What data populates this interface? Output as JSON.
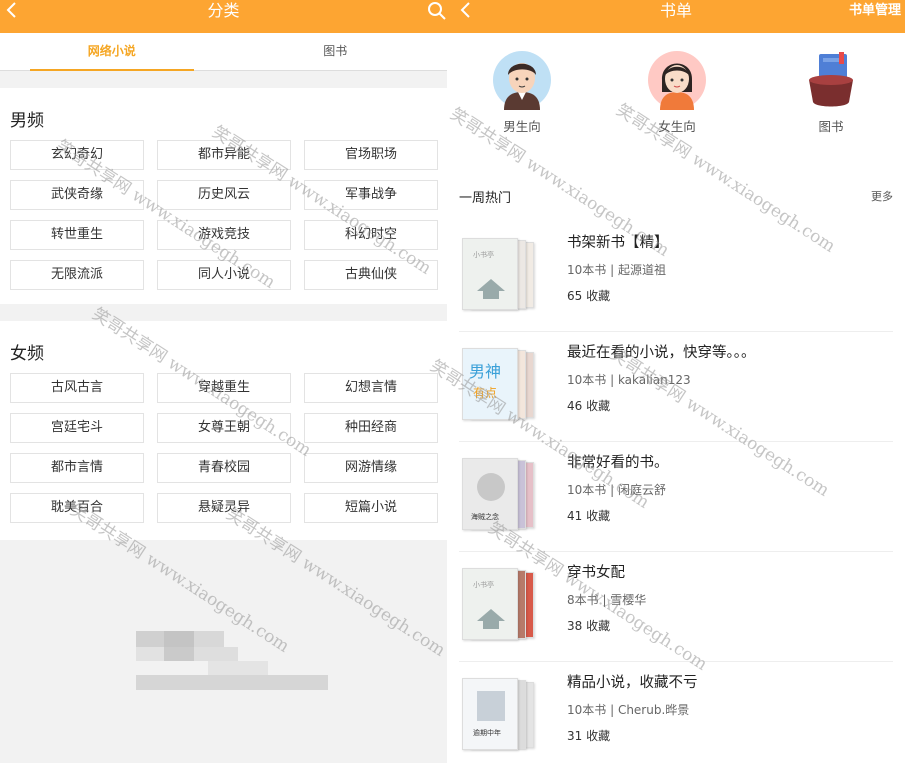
{
  "left": {
    "title": "分类",
    "tabs": [
      {
        "label": "网络小说",
        "active": true
      },
      {
        "label": "图书",
        "active": false
      }
    ],
    "sections": [
      {
        "title": "男频",
        "chips": [
          "玄幻奇幻",
          "都市异能",
          "官场职场",
          "武侠奇缘",
          "历史风云",
          "军事战争",
          "转世重生",
          "游戏竞技",
          "科幻时空",
          "无限流派",
          "同人小说",
          "古典仙侠"
        ]
      },
      {
        "title": "女频",
        "chips": [
          "古风古言",
          "穿越重生",
          "幻想言情",
          "宫廷宅斗",
          "女尊王朝",
          "种田经商",
          "都市言情",
          "青春校园",
          "网游情缘",
          "耽美百合",
          "悬疑灵异",
          "短篇小说"
        ]
      }
    ]
  },
  "right": {
    "title": "书单",
    "manage_label": "书单管理",
    "categories": [
      {
        "label": "男生向",
        "icon": "male-avatar-icon"
      },
      {
        "label": "女生向",
        "icon": "female-avatar-icon"
      },
      {
        "label": "图书",
        "icon": "book-basket-icon"
      }
    ],
    "hot_title": "一周热门",
    "more_label": "更多",
    "lists": [
      {
        "name": "书架新书【精】",
        "meta": "10本书 | 起源道祖",
        "fav": "65 收藏"
      },
      {
        "name": "最近在看的小说，快穿等。。。",
        "meta": "10本书 | kakalian123",
        "fav": "46 收藏"
      },
      {
        "name": "非常好看的书。",
        "meta": "10本书 | 闲庭云舒",
        "fav": "41 收藏"
      },
      {
        "name": "穿书女配",
        "meta": "8本书 | 雪樱华",
        "fav": "38 收藏"
      },
      {
        "name": "精品小说，收藏不亏",
        "meta": "10本书 | Cherub.晔景",
        "fav": "31 收藏"
      }
    ]
  },
  "watermark": "笑哥共享网 www.xiaogegh.com",
  "colors": {
    "accent": "#fda532",
    "tab_active": "#f5a623"
  }
}
